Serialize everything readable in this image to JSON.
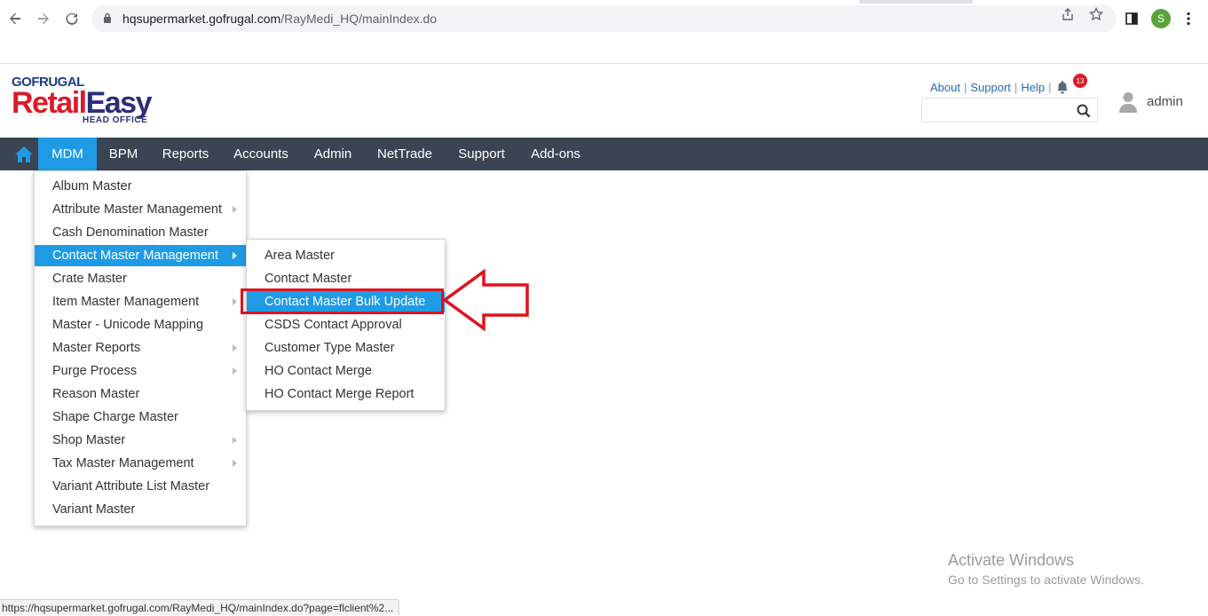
{
  "browser": {
    "url_domain": "hqsupermarket.gofrugal.com",
    "url_path": "/RayMedi_HQ/mainIndex.do",
    "profile_initial": "S",
    "status_url": "https://hqsupermarket.gofrugal.com/RayMedi_HQ/mainIndex.do?page=flclient%2..."
  },
  "header": {
    "logo_brand": "GOFRUGAL",
    "logo_retail": "Retail",
    "logo_easy": "Easy",
    "logo_sub": "HEAD OFFICE",
    "links": [
      "About",
      "Support",
      "Help"
    ],
    "notification_count": "13",
    "search_placeholder": "",
    "username": "admin"
  },
  "menubar": {
    "items": [
      "MDM",
      "BPM",
      "Reports",
      "Accounts",
      "Admin",
      "NetTrade",
      "Support",
      "Add-ons"
    ],
    "active": "MDM"
  },
  "mdm_menu": {
    "items": [
      {
        "label": "Album Master"
      },
      {
        "label": "Attribute Master Management"
      },
      {
        "label": "Cash Denomination Master"
      },
      {
        "label": "Contact Master Management"
      },
      {
        "label": "Crate Master"
      },
      {
        "label": "Item Master Management"
      },
      {
        "label": "Master - Unicode Mapping"
      },
      {
        "label": "Master Reports"
      },
      {
        "label": "Purge Process"
      },
      {
        "label": "Reason Master"
      },
      {
        "label": "Shape Charge Master"
      },
      {
        "label": "Shop Master"
      },
      {
        "label": "Tax Master Management"
      },
      {
        "label": "Variant Attribute List Master"
      },
      {
        "label": "Variant Master"
      }
    ],
    "highlighted": "Contact Master Management"
  },
  "contact_submenu": {
    "items": [
      {
        "label": "Area Master"
      },
      {
        "label": "Contact Master"
      },
      {
        "label": "Contact Master Bulk Update"
      },
      {
        "label": "CSDS Contact Approval"
      },
      {
        "label": "Customer Type Master"
      },
      {
        "label": "HO Contact Merge"
      },
      {
        "label": "HO Contact Merge Report"
      }
    ],
    "highlighted": "Contact Master Bulk Update"
  },
  "watermark": {
    "title": "Activate Windows",
    "subtitle": "Go to Settings to activate Windows."
  },
  "colors": {
    "menubar_bg": "#3b4453",
    "accent": "#1f9be6",
    "callout_red": "#e0121d"
  }
}
